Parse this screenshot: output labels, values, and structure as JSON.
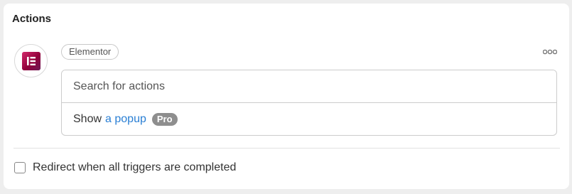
{
  "actions_panel": {
    "title": "Actions",
    "action": {
      "app_icon": "elementor-logo-icon",
      "app_icon_color": "#92003B",
      "app_chip_label": "Elementor",
      "more_icon": "more-options-icon",
      "search": {
        "value": "",
        "placeholder": "Search for actions"
      },
      "options": [
        {
          "prefix": "Show",
          "link_text": "a popup",
          "badge": "Pro"
        }
      ]
    },
    "redirect_checkbox": {
      "label": "Redirect when all triggers are completed",
      "checked": false
    }
  },
  "colors": {
    "link": "#2A7FD4",
    "pro_badge": "#8E8E8E"
  }
}
